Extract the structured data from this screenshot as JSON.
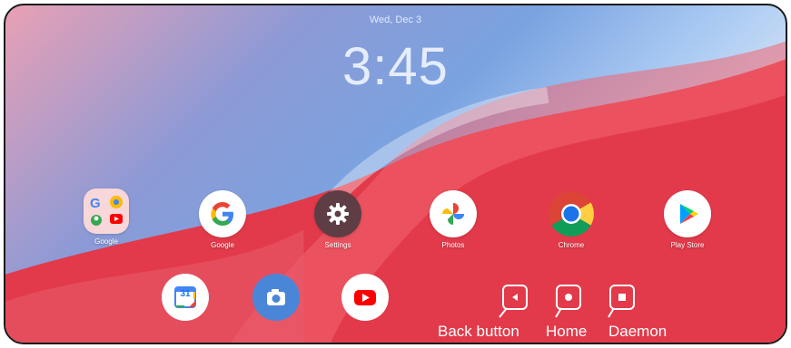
{
  "lockscreen": {
    "date": "Wed, Dec 3",
    "time": "3:45"
  },
  "apps": [
    {
      "id": "google-folder",
      "label": "Google",
      "icon": "folder-icon"
    },
    {
      "id": "google",
      "label": "Google",
      "icon": "google-icon"
    },
    {
      "id": "settings",
      "label": "Settings",
      "icon": "gear-icon"
    },
    {
      "id": "photos",
      "label": "Photos",
      "icon": "photos-icon"
    },
    {
      "id": "chrome",
      "label": "Chrome",
      "icon": "chrome-icon"
    },
    {
      "id": "play-store",
      "label": "Play Store",
      "icon": "play-store-icon"
    }
  ],
  "dock": [
    {
      "id": "calendar",
      "icon": "calendar-icon",
      "text": "31"
    },
    {
      "id": "camera",
      "icon": "camera-icon"
    },
    {
      "id": "youtube",
      "icon": "youtube-icon"
    }
  ],
  "nav": {
    "back_label": "Back button",
    "home_label": "Home",
    "daemon_label": "Daemon"
  },
  "colors": {
    "accent_red": "#e0303f",
    "wallpaper_blue": "#7aa3e0",
    "wallpaper_pink": "#e9a0b4"
  }
}
